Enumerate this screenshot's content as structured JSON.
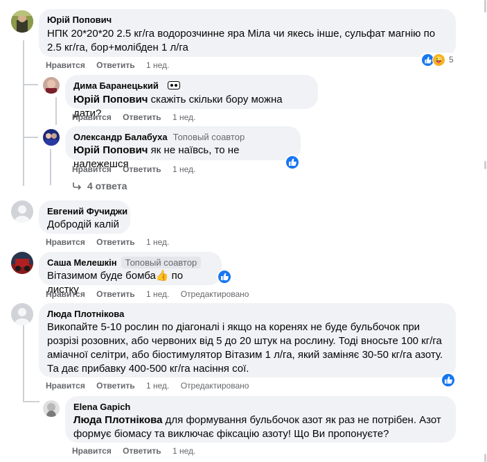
{
  "comments": [
    {
      "author": "Юрій Попович",
      "text": "НПК 20*20*20 2.5 кг/га водорозчинне яра Міла чи якесь інше, сульфат магнію по 2.5 кг/га, бор+молібден 1 л/га",
      "reaction_count": "5",
      "time": "1 нед."
    },
    {
      "author": "Дима Баранецький",
      "mention": "Юрій Попович",
      "text": " скажіть скільки бору можна дати?",
      "time": "1 нед."
    },
    {
      "author": "Олександр Балабуха",
      "badge": "Топовый соавтор",
      "mention": "Юрій Попович",
      "text": " як не наївсь, то не належешся",
      "time": "1 нед."
    },
    {
      "author": "Евгений Фучиджи",
      "text": "Добродій калій",
      "time": "1 нед."
    },
    {
      "author": "Саша Мелешкін",
      "badge": "Топовый соавтор",
      "text": "Вітазимом буде бомба👍 по листку",
      "time": "1 нед.",
      "edited": "Отредактировано"
    },
    {
      "author": "Люда Плотнікова",
      "text": "Викопайте 5-10 рослин по діагоналі і якщо на коренях не буде бульбочок при розрізі розовних, або червоних від 5 до 20 штук на рослину. Тоді вносьте 100 кг/га аміачної селітри, або біостимулятор Вітазим 1 л/га, який заміняє 30-50 кг/га азоту. Та дає прибавку 400-500 кг/га насіння сої.",
      "time": "1 нед.",
      "edited": "Отредактировано"
    },
    {
      "author": "Elena Gapich",
      "mention": "Люда Плотнікова",
      "text": " для формування бульбочок азот як раз не потрібен. Азот формує біомасу та виключає фіксацію азоту! Що Ви пропонуєте?",
      "time": "1 нед."
    }
  ],
  "actions": {
    "like": "Нравится",
    "reply": "Ответить"
  },
  "replies_link": "4 ответа",
  "colors": {
    "like_blue": "#1877f2",
    "bubble": "#f0f2f5",
    "meta": "#65676b"
  }
}
